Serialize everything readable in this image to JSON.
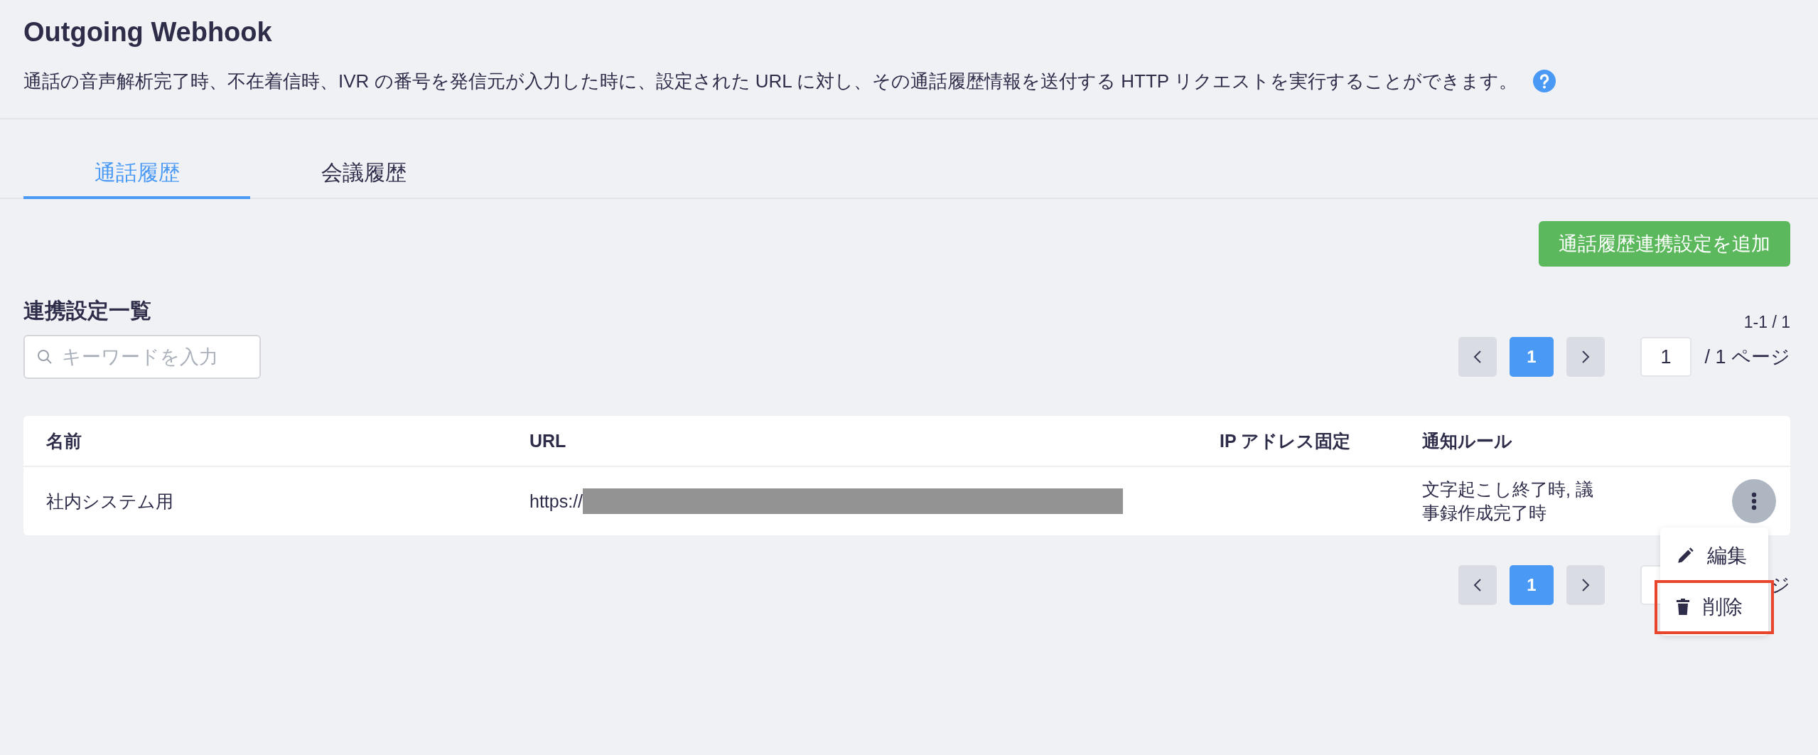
{
  "page": {
    "title": "Outgoing Webhook",
    "description": "通話の音声解析完了時、不在着信時、IVR の番号を発信元が入力した時に、設定された URL に対し、その通話履歴情報を送付する HTTP リクエストを実行することができます。"
  },
  "tabs": [
    {
      "label": "通話履歴",
      "selected": true
    },
    {
      "label": "会議履歴",
      "selected": false
    }
  ],
  "add_button": "通話履歴連携設定を追加",
  "list": {
    "heading": "連携設定一覧",
    "range": "1-1 / 1",
    "search": {
      "placeholder": "キーワードを入力"
    },
    "pager_top": {
      "pages": [
        {
          "label": "1",
          "selected": true
        }
      ],
      "page_input": "1",
      "total": "/ 1 ページ"
    },
    "table": {
      "columns": [
        "名前",
        "URL",
        "IP アドレス固定",
        "通知ルール"
      ],
      "rows": [
        {
          "name": "社内システム用",
          "url": "https://",
          "url_redacted": true,
          "notification_rule": "文字起こし終了時, 議事録作成完了時"
        }
      ]
    },
    "pager_bottom": {
      "pages": [
        {
          "label": "1",
          "selected": true
        }
      ],
      "total": "ジ"
    },
    "row_menu": {
      "items": [
        {
          "kind": "edit",
          "label": "編集",
          "highlighted": false
        },
        {
          "kind": "delete",
          "label": "削除",
          "highlighted": true
        }
      ]
    }
  }
}
